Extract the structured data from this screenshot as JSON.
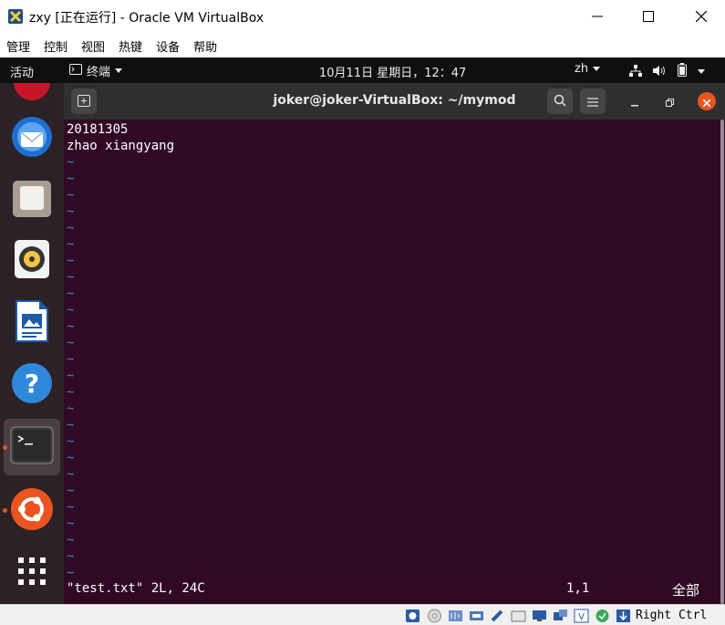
{
  "window": {
    "title": "zxy [正在运行] - Oracle VM VirtualBox",
    "min_icon": "minimize-icon",
    "max_icon": "maximize-icon",
    "close_icon": "close-icon"
  },
  "menubar": {
    "items": [
      "管理",
      "控制",
      "视图",
      "热键",
      "设备",
      "帮助"
    ]
  },
  "topbar": {
    "activities": "活动",
    "app_menu": "终端",
    "clock": "10月11日 星期日，12：47",
    "lang": "zh"
  },
  "dock": {
    "items": [
      "ubuntu-software-icon",
      "thunderbird-icon",
      "files-icon",
      "rhythmbox-icon",
      "libreoffice-writer-icon",
      "help-icon",
      "terminal-icon",
      "ubuntu-icon",
      "show-applications-icon"
    ],
    "active": "terminal-icon"
  },
  "terminal": {
    "title": "joker@joker-VirtualBox: ~/mymod",
    "lines": [
      "20181305",
      "zhao xiangyang"
    ],
    "tilde": "~",
    "status_file": "\"test.txt\" 2L, 24C",
    "status_pos": "1,1",
    "status_all": "全部"
  },
  "statusbar": {
    "host_key": "Right Ctrl"
  },
  "colors": {
    "terminal_bg": "#300a24",
    "tilde": "#3d87c9",
    "accent": "#e95420"
  }
}
